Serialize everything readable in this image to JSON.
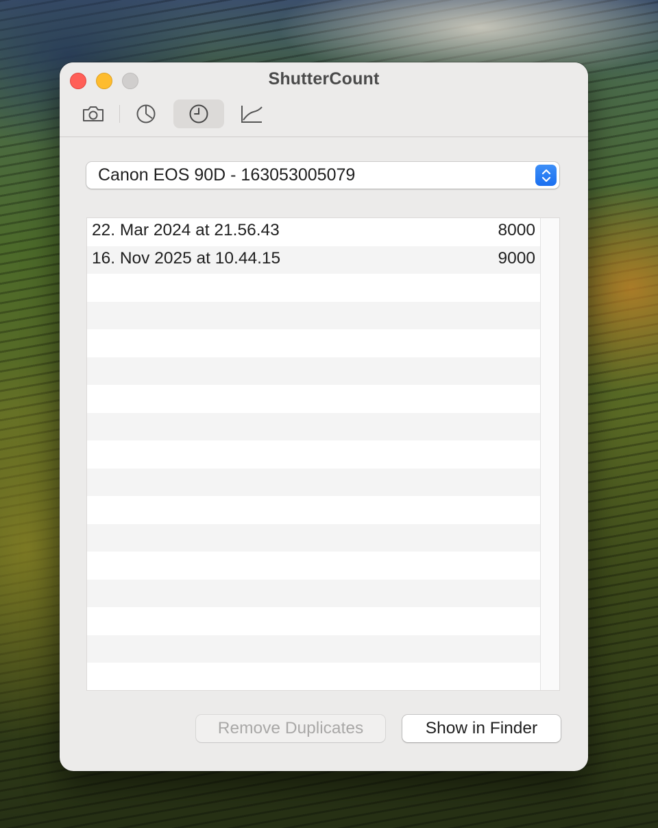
{
  "window": {
    "title": "ShutterCount",
    "toolbar": [
      {
        "icon": "camera-icon",
        "selected": false
      },
      {
        "icon": "pie-chart-icon",
        "selected": false
      },
      {
        "icon": "clock-icon",
        "selected": true
      },
      {
        "icon": "line-chart-icon",
        "selected": false
      }
    ]
  },
  "camera_select": {
    "selected": "Canon EOS 90D - 163053005079"
  },
  "history": {
    "rows": [
      {
        "date": "22. Mar 2024 at 21.56.43",
        "count": "8000"
      },
      {
        "date": "16. Nov 2025 at 10.44.15",
        "count": "9000"
      }
    ]
  },
  "buttons": {
    "remove_duplicates": "Remove Duplicates",
    "show_in_finder": "Show in Finder"
  },
  "colors": {
    "accent": "#1a6ff0",
    "close": "#ff5f57",
    "minimize": "#febc2e",
    "zoom_disabled": "#d0cecd"
  }
}
